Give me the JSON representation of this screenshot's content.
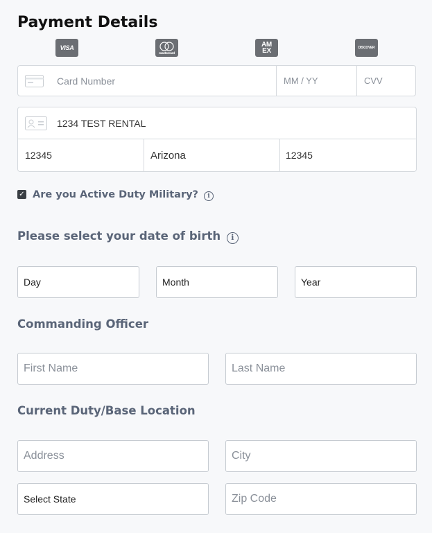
{
  "title": "Payment Details",
  "card_logos": [
    {
      "name": "visa-logo",
      "text": "VISA"
    },
    {
      "name": "mastercard-logo",
      "text": "mastercard"
    },
    {
      "name": "amex-logo",
      "text": "AMEX"
    },
    {
      "name": "discover-logo",
      "text": "DISCOVER"
    }
  ],
  "card": {
    "number_placeholder": "Card Number",
    "expiry_placeholder": "MM / YY",
    "cvv_placeholder": "CVV"
  },
  "billing": {
    "name_value": "1234 TEST RENTAL",
    "zip_value": "12345",
    "state_value": "Arizona",
    "second_zip_value": "12345"
  },
  "military": {
    "checked": true,
    "label": "Are you Active Duty Military?",
    "info_icon": "i"
  },
  "dob": {
    "heading": "Please select your date of birth",
    "info_icon": "i",
    "day": "Day",
    "month": "Month",
    "year": "Year"
  },
  "officer": {
    "heading": "Commanding Officer",
    "first_name_placeholder": "First Name",
    "last_name_placeholder": "Last Name"
  },
  "duty": {
    "heading": "Current Duty/Base Location",
    "address_placeholder": "Address",
    "city_placeholder": "City",
    "state_select": "Select State",
    "zip_placeholder": "Zip Code"
  }
}
